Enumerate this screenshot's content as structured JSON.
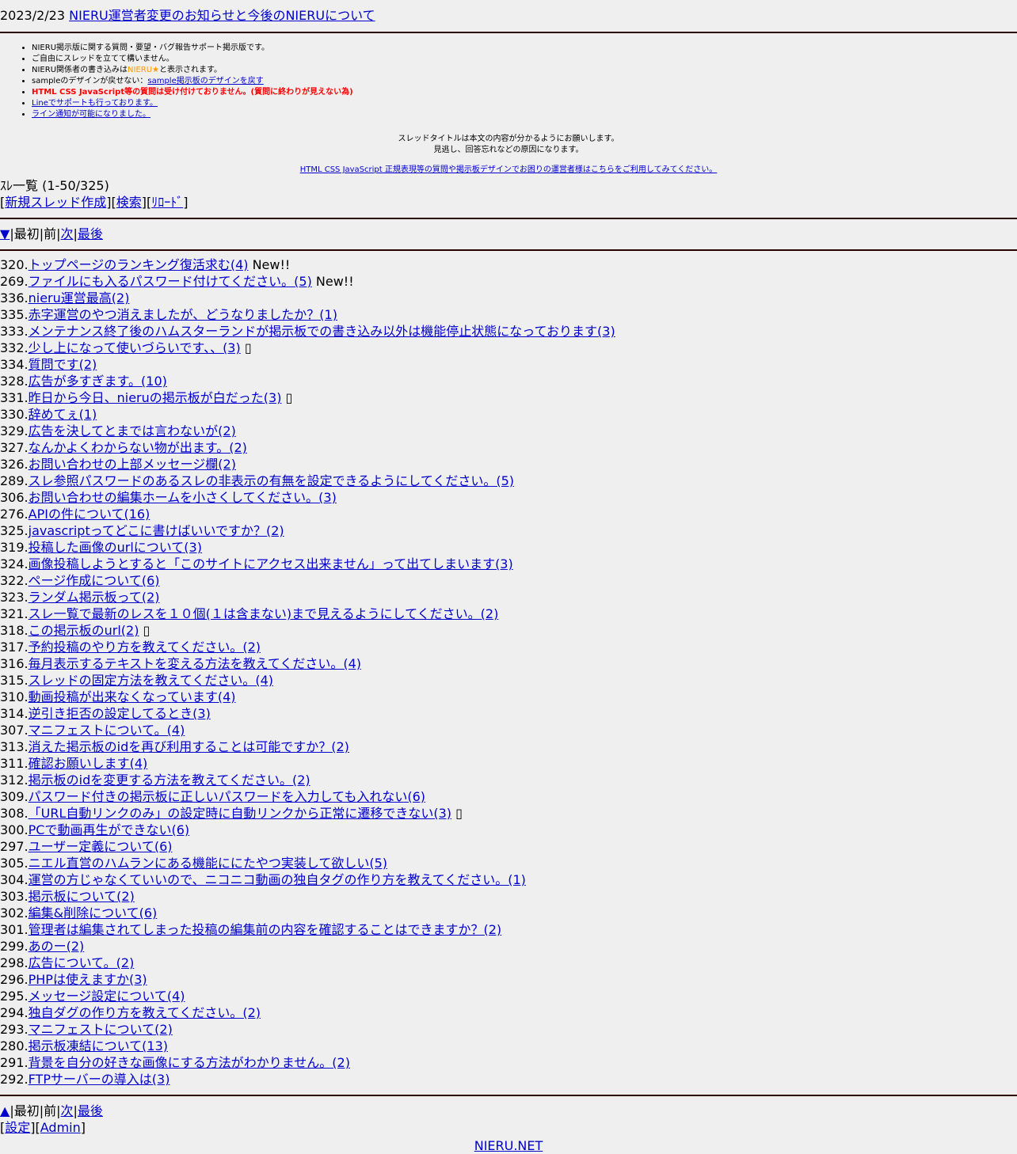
{
  "news": {
    "date": "2023/2/23",
    "link_text": "NIERU運営者変更のお知らせと今後のNIERUについて"
  },
  "notes": {
    "line1": "NIERU掲示版に関する質問・要望・バグ報告サポート掲示版です。",
    "line2": "ご自由にスレッドを立てて構いません。",
    "line3_pre": "NIERU関係者の書き込みは",
    "line3_mark": "NIERU★",
    "line3_post": "と表示されます。",
    "line4_pre": "sampleのデザインが戻せない：",
    "line4_link": "sample掲示板のデザインを戻す",
    "line5": "HTML CSS JavaScript等の質問は受け付けておりません。(質問に終わりが見えない為)",
    "line6": "Lineでサポートも行っております。",
    "line7": "ライン通知が可能になりました。"
  },
  "center": {
    "msg1": "スレッドタイトルは本文の内容が分かるようにお願いします。",
    "msg2": "見逃し、回答忘れなどの原因になります。",
    "link": "HTML CSS JavaScript 正規表現等の質問や掲示板デザインでお困りの運営者様はこちらをご利用してみてください。"
  },
  "list_header": {
    "title": "ｽﾚ一覧 (1-50/325)",
    "new_thread": "新規スレッド作成",
    "search": "検索",
    "reload": "ﾘﾛｰﾄﾞ"
  },
  "nav_top": {
    "arrow": "▼",
    "first": "最初",
    "prev": "前",
    "next": "次",
    "last": "最後"
  },
  "nav_bottom": {
    "arrow": "▲",
    "first": "最初",
    "prev": "前",
    "next": "次",
    "last": "最後"
  },
  "bottom_links": {
    "settings": "設定",
    "admin": "Admin"
  },
  "footer": {
    "site": "NIERU.NET"
  },
  "threads": [
    {
      "no": "320.",
      "title": "トップページのランキング復活求む(4)",
      "suffix": " New!!"
    },
    {
      "no": "269.",
      "title": "ファイルにも入るパスワード付けてください。(5)",
      "suffix": " New!!"
    },
    {
      "no": "336.",
      "title": "nieru運営最高(2)",
      "suffix": ""
    },
    {
      "no": "335.",
      "title": "赤字運営のやつ消えましたが、どうなりましたか？(1)",
      "suffix": ""
    },
    {
      "no": "333.",
      "title": "メンテナンス終了後のハムスターランドが掲示板での書き込み以外は機能停止状態になっております(3)",
      "suffix": ""
    },
    {
      "no": "332.",
      "title": "少し上になって使いづらいです、、(3)",
      "suffix": " ▯"
    },
    {
      "no": "334.",
      "title": "質問です(2)",
      "suffix": ""
    },
    {
      "no": "328.",
      "title": "広告が多すぎます。(10)",
      "suffix": ""
    },
    {
      "no": "331.",
      "title": "昨日から今日、nieruの掲示板が白だった(3)",
      "suffix": " ▯"
    },
    {
      "no": "330.",
      "title": "辞めてぇ(1)",
      "suffix": ""
    },
    {
      "no": "329.",
      "title": "広告を決してとまでは言わないが(2)",
      "suffix": ""
    },
    {
      "no": "327.",
      "title": "なんかよくわからない物が出ます。(2)",
      "suffix": ""
    },
    {
      "no": "326.",
      "title": "お問い合わせの上部メッセージ欄(2)",
      "suffix": ""
    },
    {
      "no": "289.",
      "title": "スレ参照パスワードのあるスレの非表示の有無を設定できるようにしてください。(5)",
      "suffix": ""
    },
    {
      "no": "306.",
      "title": "お問い合わせの編集ホームを小さくしてください。(3)",
      "suffix": ""
    },
    {
      "no": "276.",
      "title": "APIの件について(16)",
      "suffix": ""
    },
    {
      "no": "325.",
      "title": "javascriptってどこに書けばいいですか？(2)",
      "suffix": ""
    },
    {
      "no": "319.",
      "title": "投稿した画像のurlについて(3)",
      "suffix": ""
    },
    {
      "no": "324.",
      "title": "画像投稿しようとすると「このサイトにアクセス出来ません」って出てしまいます(3)",
      "suffix": ""
    },
    {
      "no": "322.",
      "title": "ページ作成について(6)",
      "suffix": ""
    },
    {
      "no": "323.",
      "title": "ランダム掲示板って(2)",
      "suffix": ""
    },
    {
      "no": "321.",
      "title": "スレ一覧で最新のレスを１０個(１は含まない)まで見えるようにしてください。(2)",
      "suffix": ""
    },
    {
      "no": "318.",
      "title": "この掲示板のurl(2)",
      "suffix": " ▯"
    },
    {
      "no": "317.",
      "title": "予約投稿のやり方を教えてください。(2)",
      "suffix": ""
    },
    {
      "no": "316.",
      "title": "毎月表示するテキストを変える方法を教えてください。(4)",
      "suffix": ""
    },
    {
      "no": "315.",
      "title": "スレッドの固定方法を教えてください。(4)",
      "suffix": ""
    },
    {
      "no": "310.",
      "title": "動画投稿が出来なくなっています(4)",
      "suffix": ""
    },
    {
      "no": "314.",
      "title": "逆引き拒否の設定してるとき(3)",
      "suffix": ""
    },
    {
      "no": "307.",
      "title": "マニフェストについて。(4)",
      "suffix": ""
    },
    {
      "no": "313.",
      "title": "消えた掲示板のidを再び利用することは可能ですか？(2)",
      "suffix": ""
    },
    {
      "no": "311.",
      "title": "確認お願いします(4)",
      "suffix": ""
    },
    {
      "no": "312.",
      "title": "掲示板のidを変更する方法を教えてください。(2)",
      "suffix": ""
    },
    {
      "no": "309.",
      "title": "パスワード付きの掲示板に正しいパスワードを入力しても入れない(6)",
      "suffix": ""
    },
    {
      "no": "308.",
      "title": "「URL自動リンクのみ」の設定時に自動リンクから正常に遷移できない(3)",
      "suffix": " ▯"
    },
    {
      "no": "300.",
      "title": "PCで動画再生ができない(6)",
      "suffix": ""
    },
    {
      "no": "297.",
      "title": "ユーザー定義について(6)",
      "suffix": ""
    },
    {
      "no": "305.",
      "title": "ニエル直営のハムランにある機能ににたやつ実装して欲しい(5)",
      "suffix": ""
    },
    {
      "no": "304.",
      "title": "運営の方じゃなくていいので、ニコニコ動画の独自タグの作り方を教えてください。(1)",
      "suffix": ""
    },
    {
      "no": "303.",
      "title": "掲示板について(2)",
      "suffix": ""
    },
    {
      "no": "302.",
      "title": "編集&削除について(6)",
      "suffix": ""
    },
    {
      "no": "301.",
      "title": "管理者は編集されてしまった投稿の編集前の内容を確認することはできますか？(2)",
      "suffix": ""
    },
    {
      "no": "299.",
      "title": "あのー(2)",
      "suffix": ""
    },
    {
      "no": "298.",
      "title": "広告について。(2)",
      "suffix": ""
    },
    {
      "no": "296.",
      "title": "PHPは使えますか(3)",
      "suffix": ""
    },
    {
      "no": "295.",
      "title": "メッセージ設定について(4)",
      "suffix": ""
    },
    {
      "no": "294.",
      "title": "独自ダグの作り方を教えてください。(2)",
      "suffix": ""
    },
    {
      "no": "293.",
      "title": "マニフェストについて(2)",
      "suffix": ""
    },
    {
      "no": "280.",
      "title": "掲示板凍結について(13)",
      "suffix": ""
    },
    {
      "no": "291.",
      "title": "背景を自分の好きな画像にする方法がわかりません。(2)",
      "suffix": ""
    },
    {
      "no": "292.",
      "title": "FTPサーバーの導入は(3)",
      "suffix": ""
    }
  ]
}
